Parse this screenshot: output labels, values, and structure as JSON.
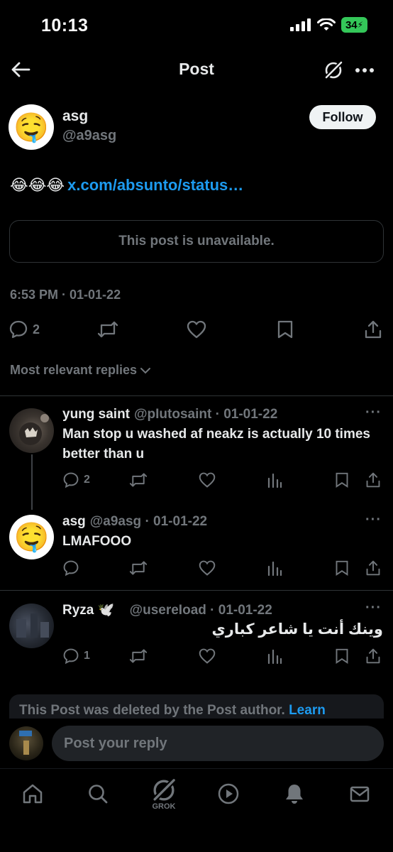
{
  "status_bar": {
    "time": "10:13",
    "battery": "34"
  },
  "header": {
    "title": "Post"
  },
  "post": {
    "author_name": "asg",
    "author_handle": "@a9asg",
    "follow_label": "Follow",
    "emojis": "😂😂😂",
    "link_text": "x.com/absunto/status…",
    "unavailable_text": "This post is unavailable.",
    "timestamp": "6:53 PM · 01-01-22",
    "reply_count": "2"
  },
  "sort_label": "Most relevant replies",
  "replies": [
    {
      "name": "yung saint",
      "handle": "@pIutosaint",
      "date": "· 01-01-22",
      "text": "Man stop u washed af neakz is actually 10 times better than u",
      "reply_count": "2"
    },
    {
      "name": "asg",
      "handle": "@a9asg",
      "date": "· 01-01-22",
      "text": "LMAFOOO",
      "reply_count": ""
    },
    {
      "name": "Ryza 🕊️",
      "handle": "@usereIoad",
      "date": "· 01-01-22",
      "text": "وينك أنت يا شاعر كباري",
      "reply_count": "1"
    }
  ],
  "deleted_notice": {
    "text": "This Post was deleted by the Post author.",
    "link": "Learn"
  },
  "composer": {
    "placeholder": "Post your reply"
  },
  "tabbar": {
    "grok_label": "GROK"
  },
  "colors": {
    "accent": "#1d9bf0",
    "muted": "#71767b",
    "battery": "#34c759"
  }
}
